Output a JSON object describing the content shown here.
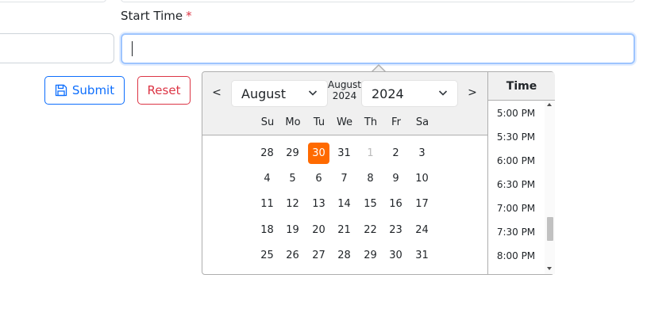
{
  "form": {
    "start_time_label": "Start Time",
    "required_mark": "*",
    "start_time_value": ""
  },
  "buttons": {
    "submit_label": "Submit",
    "reset_label": "Reset"
  },
  "datepicker": {
    "prev": "<",
    "next": ">",
    "month_select": "August",
    "year_select": "2024",
    "current_month": "August",
    "current_year": "2024",
    "weekdays": [
      "Su",
      "Mo",
      "Tu",
      "We",
      "Th",
      "Fr",
      "Sa"
    ],
    "weeks": [
      [
        "28",
        "29",
        "30",
        "31",
        "1",
        "2",
        "3"
      ],
      [
        "4",
        "5",
        "6",
        "7",
        "8",
        "9",
        "10"
      ],
      [
        "11",
        "12",
        "13",
        "14",
        "15",
        "16",
        "17"
      ],
      [
        "18",
        "19",
        "20",
        "21",
        "22",
        "23",
        "24"
      ],
      [
        "25",
        "26",
        "27",
        "28",
        "29",
        "30",
        "31"
      ]
    ],
    "selected_day": "30",
    "time_header": "Time",
    "times": [
      "5:00 PM",
      "5:30 PM",
      "6:00 PM",
      "6:30 PM",
      "7:00 PM",
      "7:30 PM",
      "8:00 PM"
    ]
  },
  "colors": {
    "primary": "#0d6efd",
    "danger": "#dc3545",
    "selected_day": "#ff6a00"
  }
}
